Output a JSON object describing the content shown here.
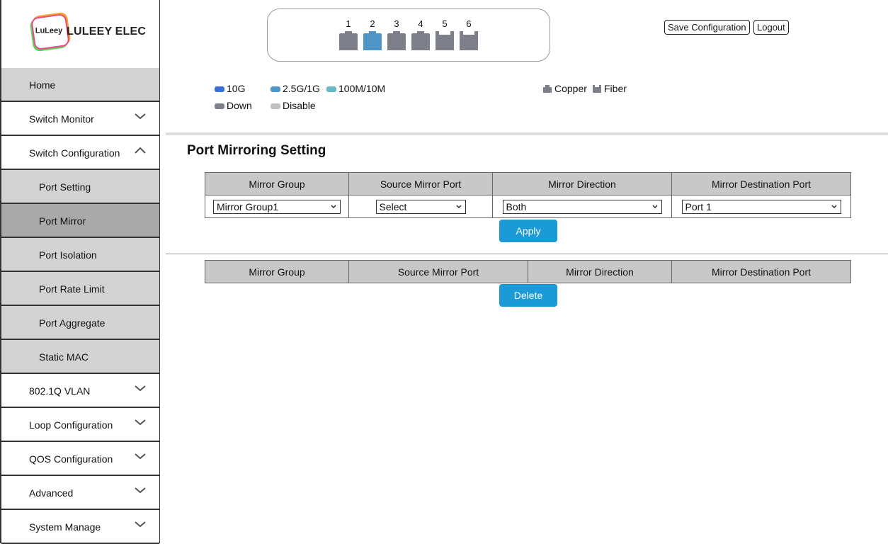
{
  "brand": {
    "badge_text": "LuLeey",
    "name": "LULEEY ELEC"
  },
  "sidebar": {
    "items": [
      {
        "label": "Home",
        "type": "gray"
      },
      {
        "label": "Switch Monitor",
        "type": "top",
        "chevron": "down"
      },
      {
        "label": "Switch Configuration",
        "type": "top",
        "chevron": "up"
      },
      {
        "label": "Port Setting",
        "type": "sub"
      },
      {
        "label": "Port Mirror",
        "type": "sub-active"
      },
      {
        "label": "Port Isolation",
        "type": "sub"
      },
      {
        "label": "Port Rate Limit",
        "type": "sub"
      },
      {
        "label": "Port Aggregate",
        "type": "sub"
      },
      {
        "label": "Static MAC",
        "type": "sub"
      },
      {
        "label": "802.1Q VLAN",
        "type": "top",
        "chevron": "down"
      },
      {
        "label": "Loop Configuration",
        "type": "top",
        "chevron": "down"
      },
      {
        "label": "QOS Configuration",
        "type": "top",
        "chevron": "down"
      },
      {
        "label": "Advanced",
        "type": "top",
        "chevron": "down"
      },
      {
        "label": "System Manage",
        "type": "top",
        "chevron": "down"
      }
    ]
  },
  "ports": [
    {
      "num": "1",
      "kind": "copper",
      "color": "#7d808a"
    },
    {
      "num": "2",
      "kind": "copper",
      "color": "#4f95c8"
    },
    {
      "num": "3",
      "kind": "copper",
      "color": "#7d808a"
    },
    {
      "num": "4",
      "kind": "copper",
      "color": "#7d808a"
    },
    {
      "num": "5",
      "kind": "fiber",
      "color": "#7d808a"
    },
    {
      "num": "6",
      "kind": "fiber",
      "color": "#7d808a"
    }
  ],
  "header": {
    "save_label": "Save Configuration",
    "logout_label": "Logout"
  },
  "legend": {
    "speed_10g": {
      "label": "10G",
      "color": "#3b6fd8"
    },
    "speed_2_5g": {
      "label": "2.5G/1G",
      "color": "#4f95c8"
    },
    "speed_100m": {
      "label": "100M/10M",
      "color": "#67b8c8"
    },
    "down": {
      "label": "Down",
      "color": "#7d808a"
    },
    "disable": {
      "label": "Disable",
      "color": "#c0c0c0"
    },
    "copper": {
      "label": "Copper"
    },
    "fiber": {
      "label": "Fiber"
    }
  },
  "main": {
    "title": "Port Mirroring Setting",
    "form_headers": [
      "Mirror Group",
      "Source Mirror Port",
      "Mirror Direction",
      "Mirror Destination Port"
    ],
    "mirror_group_value": "Mirror Group1",
    "source_port_value": "Select",
    "direction_value": "Both",
    "dest_port_value": "Port 1",
    "apply_label": "Apply",
    "list_headers": [
      "Mirror Group",
      "Source Mirror Port",
      "Mirror Direction",
      "Mirror Destination Port"
    ],
    "delete_label": "Delete"
  },
  "colors": {
    "accent": "#1a9ad6",
    "menu_gray": "#d3d3d3",
    "menu_active": "#a9a9a9"
  }
}
